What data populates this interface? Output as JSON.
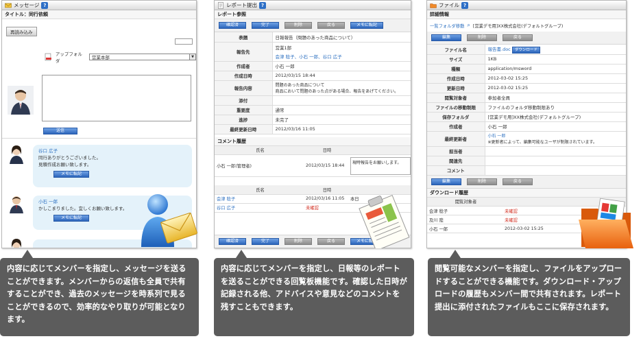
{
  "panel_message": {
    "title": "メッセージ",
    "subtitle": "タイトル：同行依頼",
    "reread_button": "再読み込み",
    "upload_folder_label": "アップフォルダ",
    "upload_folder_value": "営業本部",
    "send_button": "送信",
    "messages": [
      {
        "sender": "谷口 広子",
        "body1": "同行ありがとうございました。",
        "body2": "見積作成お願い致します。",
        "button": "メモに転記"
      },
      {
        "sender": "小石 一郎",
        "body1": "かしこまりました。宜しくお願い致します。",
        "body2": "",
        "button": "メモに転記"
      }
    ]
  },
  "panel_report": {
    "title": "レポート提出",
    "subtitle": "レポート参照",
    "buttons": [
      "確認済",
      "完了",
      "削除",
      "戻る",
      "メモに転記"
    ],
    "fields": [
      {
        "key": "表題",
        "value": "日報報告（問題のあった商品について）"
      },
      {
        "key": "報告先",
        "value": "営業1部",
        "value2": "会津 稔子、小石 一郎、谷口 広子"
      },
      {
        "key": "作成者",
        "value": "小石 一郎"
      },
      {
        "key": "作成日時",
        "value": "2012/03/15 18:44"
      },
      {
        "key": "報告内容",
        "value": "問題のあった商品について",
        "value2": "商品において問題のあった点がある場合、報告をあげてください。"
      },
      {
        "key": "添付",
        "value": ""
      },
      {
        "key": "重要度",
        "value": "通常"
      },
      {
        "key": "進捗",
        "value": "未完了"
      },
      {
        "key": "最終更新日時",
        "value": "2012/03/16 11:05"
      }
    ],
    "comment_section": "コメント履歴",
    "comment_headers": [
      "氏名",
      "日時"
    ],
    "comment_row": {
      "name": "小石 一郎(管理者)",
      "date": "2012/03/15 18:44",
      "comment": "現時報告をお願いします。"
    },
    "status_headers": [
      "氏名",
      "日時"
    ],
    "status_rows": [
      {
        "name": "会津 稔子",
        "date": "2012/03/16 11:05",
        "note": "本日"
      },
      {
        "name": "谷口 広子",
        "date": "未確認",
        "note": ""
      }
    ]
  },
  "panel_file": {
    "title": "ファイル",
    "subtitle": "詳細情報",
    "breadcrumb_link": "一覧フォルダ移動",
    "breadcrumb_path": "[営業デモ用]XX株式会社(デフォルトグループ)",
    "buttons_top": [
      "編集",
      "削除",
      "戻る"
    ],
    "fields": [
      {
        "key": "ファイル名",
        "value": "報告書.doc",
        "badge": "ダウンロード"
      },
      {
        "key": "サイズ",
        "value": "1KB"
      },
      {
        "key": "種類",
        "value": "application/msword"
      },
      {
        "key": "作成日時",
        "value": "2012-03-02 15:25"
      },
      {
        "key": "更新日時",
        "value": "2012-03-02 15:25"
      },
      {
        "key": "閲覧対象者",
        "value": "参加者全員"
      },
      {
        "key": "ファイルの移動制限",
        "value": "ファイルのフォルダ移動制限あり"
      },
      {
        "key": "保存フォルダ",
        "value": "[営業デモ用]XX株式会社(デフォルトグループ)"
      },
      {
        "key": "作成者",
        "value": "小石 一郎"
      },
      {
        "key": "最終更新者",
        "value": "小石 一郎",
        "value2": "※更新者によって、編集可能なユーザが制限されています。"
      },
      {
        "key": "担当者",
        "value": ""
      },
      {
        "key": "関連先",
        "value": ""
      },
      {
        "key": "コメント",
        "value": ""
      }
    ],
    "buttons_bottom": [
      "編集",
      "削除",
      "戻る"
    ],
    "download_section": "ダウンロード履歴",
    "download_header": "閲覧対象者",
    "download_rows": [
      {
        "name": "会津 稔子",
        "status": "未確認"
      },
      {
        "name": "及川 陸",
        "status": "未確認"
      },
      {
        "name": "小石 一郎",
        "status": "2012-03-02 15:25"
      }
    ]
  },
  "captions": [
    "内容に応じてメンバーを指定し、メッセージを送ることができます。メンバーからの返信も全員で共有することができ、過去のメッセージを時系列で見ることができるので、効率的なやり取りが可能となります。",
    "内容に応じてメンバーを指定し、日報等のレポートを送ることができる回覧板機能です。確認した日時が記録される他、アドバイスや意見などのコメントを残すこともできます。",
    "閲覧可能なメンバーを指定し、ファイルをアップロードすることができる機能です。ダウンロード・アップロードの履歴もメンバー間で共有されます。レポート提出に添付されたファイルもここに保存されます。"
  ],
  "colors": {
    "accent_blue": "#2c65bb",
    "link_blue": "#2b6fc0",
    "caption_bg": "#5c5c5c",
    "red": "#d12b1d",
    "message_bubble": "#e4f2fa"
  }
}
